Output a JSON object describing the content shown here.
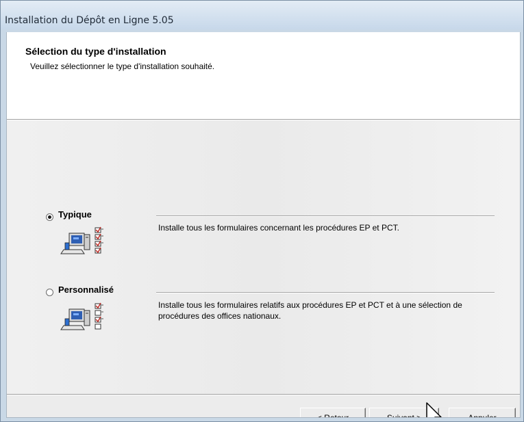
{
  "window": {
    "title": "Installation du Dépôt en Ligne 5.05"
  },
  "header": {
    "title": "Sélection du type d'installation",
    "subtitle": "Veuillez sélectionner le type d'installation souhaité."
  },
  "options": [
    {
      "label": "Typique",
      "selected": true,
      "description": "Installe tous les formulaires concernant les procédures EP et PCT.",
      "icon": "computer-checklist-icon"
    },
    {
      "label": "Personnalisé",
      "selected": false,
      "description": "Installe tous les formulaires relatifs aux procédures EP et PCT et à une sélection de procédures des offices nationaux.",
      "icon": "computer-checklist-icon"
    }
  ],
  "buttons": {
    "back": "< Retour",
    "next": "Suivant >",
    "cancel": "Annuler"
  },
  "colors": {
    "titlebar": "#c7d8ea",
    "dialog_background": "#ececec",
    "header_background": "#ffffff",
    "checkmark_red": "#c0302a"
  }
}
